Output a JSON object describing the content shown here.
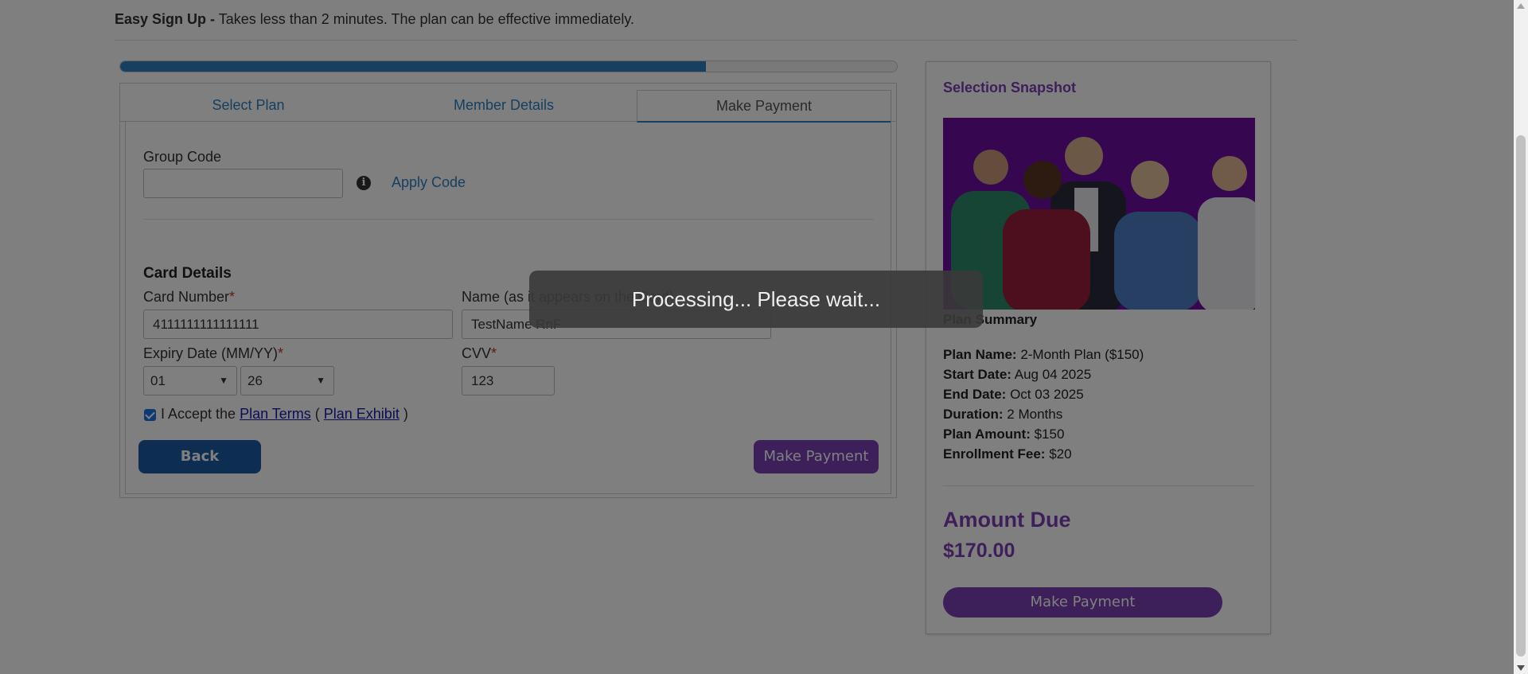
{
  "intro": {
    "bold": "Easy Sign Up -",
    "text": " Takes less than 2 minutes. The plan can be effective immediately."
  },
  "progress": {
    "value_percent": 75.4
  },
  "tabs": [
    {
      "label": "Select Plan",
      "active": false
    },
    {
      "label": "Member Details",
      "active": false
    },
    {
      "label": "Make Payment",
      "active": true
    }
  ],
  "group_code": {
    "label": "Group Code",
    "value": "",
    "placeholder": "",
    "apply_label": "Apply Code",
    "info_icon": "info-circle-icon"
  },
  "card": {
    "title": "Card Details",
    "number_label": "Card Number",
    "number_value": "4111111111111111",
    "name_label": "Name (as it appears on the Card)",
    "name_value": "TestName RnF",
    "expiry_label": "Expiry Date (MM/YY)",
    "expiry_month": "01",
    "expiry_year": "26",
    "cvv_label": "CVV",
    "cvv_value": "123",
    "required_mark": "*"
  },
  "accept": {
    "checked": true,
    "prefix": "I Accept the ",
    "terms_link": "Plan Terms",
    "open_paren": " ( ",
    "exhibit_link": "Plan Exhibit",
    "close_paren": " )"
  },
  "buttons": {
    "back": "Back",
    "make_payment": "Make Payment"
  },
  "snapshot": {
    "title": "Selection Snapshot",
    "summary_title": "Plan Summary",
    "rows": [
      {
        "label": "Plan Name:",
        "value": " 2-Month Plan ($150)"
      },
      {
        "label": "Start Date:",
        "value": " Aug 04 2025"
      },
      {
        "label": "End Date:",
        "value": " Oct 03 2025"
      },
      {
        "label": "Duration:",
        "value": " 2 Months"
      },
      {
        "label": "Plan Amount:",
        "value": " $150"
      },
      {
        "label": "Enrollment Fee:",
        "value": " $20"
      }
    ],
    "amount_due_label": "Amount Due",
    "amount_due_value": "$170.00",
    "pay_button": "Make Payment"
  },
  "overlay": {
    "message": "Processing... Please wait..."
  },
  "colors": {
    "primary_blue": "#2f7ec1",
    "back_button": "#1a5aa6",
    "purple": "#7b3fb3",
    "photo_bg": "#6f0da3",
    "required": "#c0392b"
  }
}
